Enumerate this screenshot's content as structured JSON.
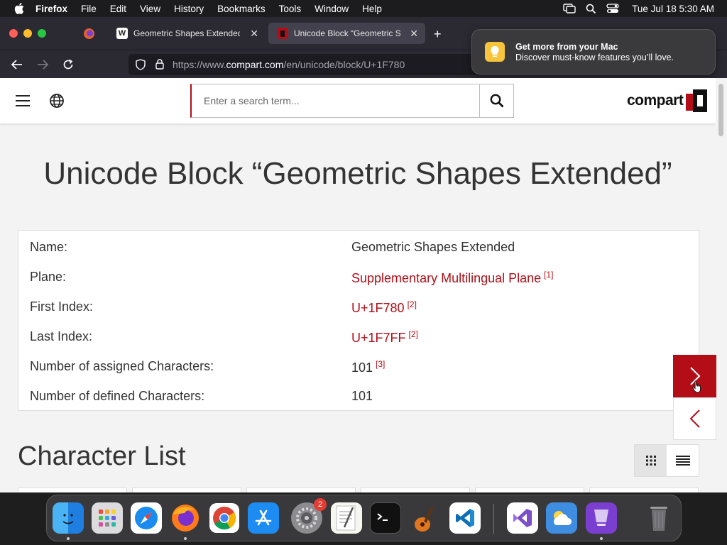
{
  "menubar": {
    "items": [
      "Firefox",
      "File",
      "Edit",
      "View",
      "History",
      "Bookmarks",
      "Tools",
      "Window",
      "Help"
    ],
    "clock": "Tue Jul 18  5:30 AM"
  },
  "tabs": [
    {
      "title": "Geometric Shapes Extended - W",
      "favicon": "W"
    },
    {
      "title": "Unicode Block “Geometric Shap",
      "favicon": ""
    }
  ],
  "url": {
    "prefix": "https://www.",
    "domain": "compart.com",
    "path": "/en/unicode/block/U+1F780"
  },
  "notification": {
    "title": "Get more from your Mac",
    "body": "Discover must-know features you’ll love."
  },
  "site": {
    "search_placeholder": "Enter a search term...",
    "logo_text": "compart"
  },
  "page": {
    "title": "Unicode Block “Geometric Shapes Extended”",
    "section_title": "Character List"
  },
  "info": {
    "rows": [
      {
        "key": "Name:",
        "value": "Geometric Shapes Extended",
        "ref": ""
      },
      {
        "key": "Plane:",
        "value": "Supplementary Multilingual Plane",
        "ref": "[1]"
      },
      {
        "key": "First Index:",
        "value": "U+1F780",
        "ref": "[2]"
      },
      {
        "key": "Last Index:",
        "value": "U+1F7FF",
        "ref": "[2]"
      },
      {
        "key": "Number of assigned Characters:",
        "value": "101",
        "ref": "[3]"
      },
      {
        "key": "Number of defined Characters:",
        "value": "101",
        "ref": ""
      }
    ]
  },
  "dock": {
    "settings_badge": "2"
  },
  "colors": {
    "accent": "#b30e18",
    "page_bg": "#f3f3f3"
  }
}
